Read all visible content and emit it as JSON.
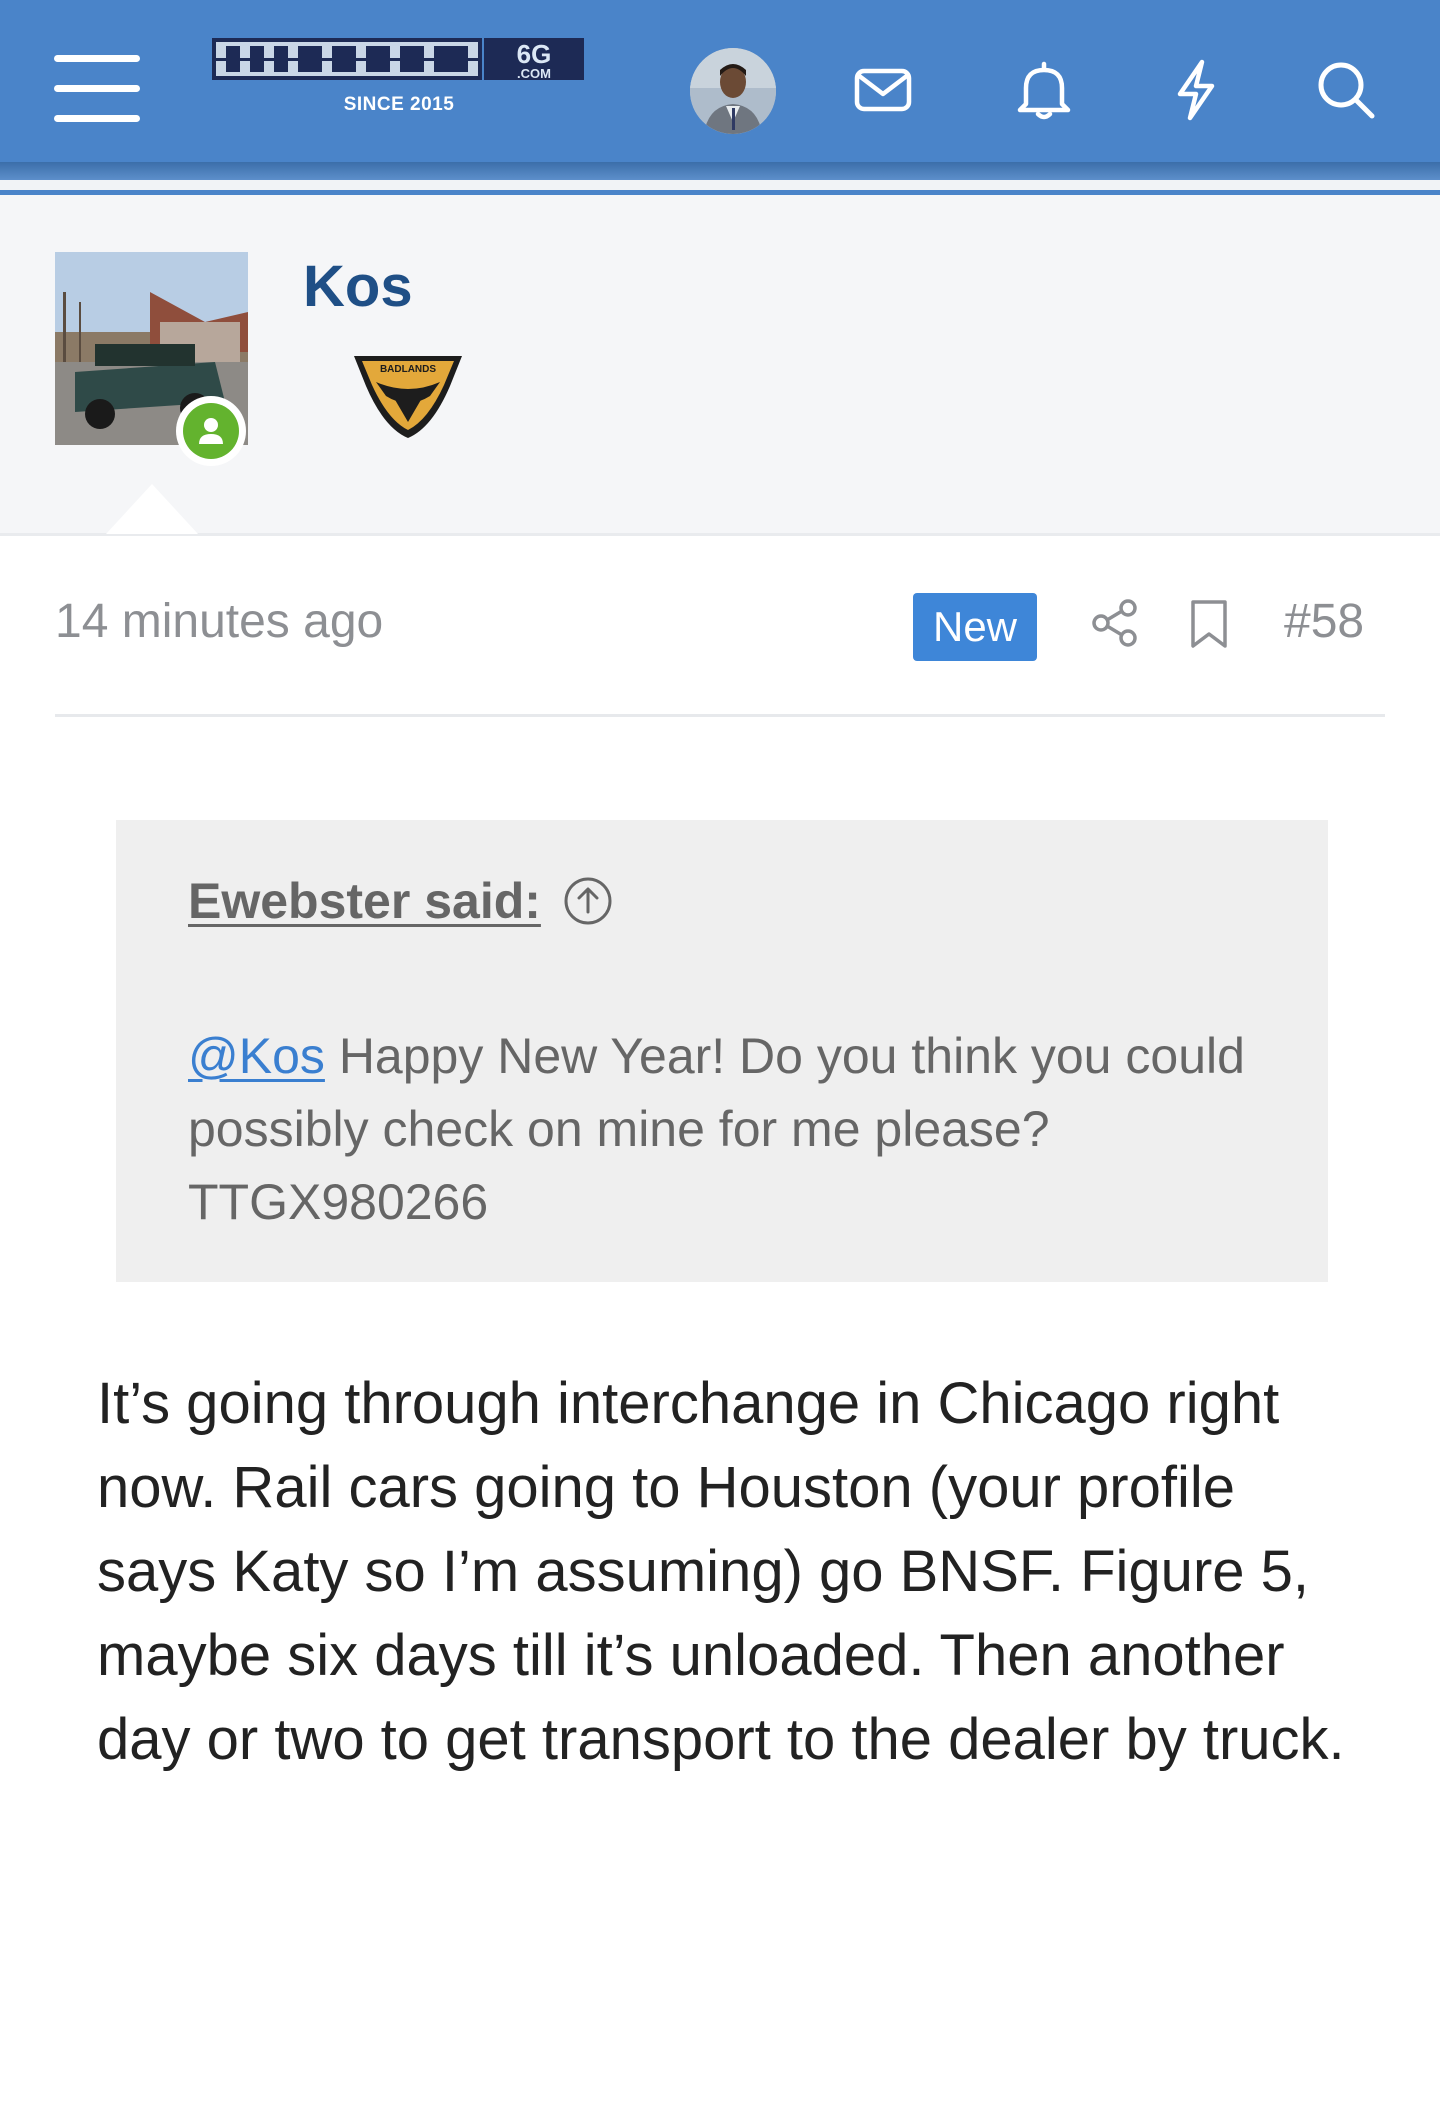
{
  "header": {
    "logo_text": "BRONCO6G.COM",
    "logo_since": "SINCE 2015",
    "icons": [
      "menu-icon",
      "user-avatar",
      "mail-icon",
      "bell-icon",
      "lightning-icon",
      "search-icon"
    ],
    "colors": {
      "bar": "#4a84c9",
      "accent": "#3e86d8"
    }
  },
  "post": {
    "author": "Kos",
    "author_badge_text": "BADLANDS",
    "online": true,
    "time": "14 minutes ago",
    "new_label": "New",
    "post_number": "#58",
    "quote": {
      "author_label": "Ewebster said:",
      "mention": "@Kos",
      "text_after_mention": " Happy New Year! Do you think you could possibly check on mine for me please? TTGX980266"
    },
    "body": "It’s going through interchange in Chicago right now. Rail cars going to Houston (your profile says Katy so I’m assuming) go BNSF. Figure 5, maybe six days till it’s unloaded. Then another day or two to get transport to the dealer by truck."
  }
}
